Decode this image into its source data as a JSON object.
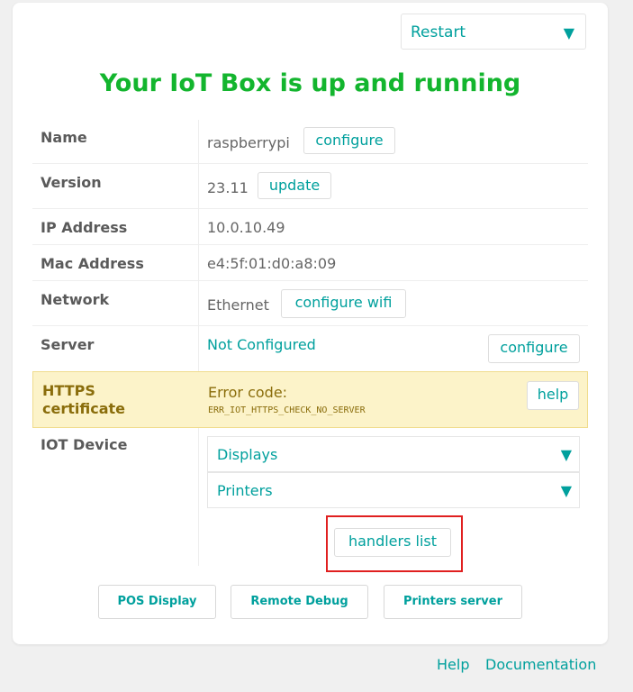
{
  "header": {
    "restart_label": "Restart",
    "restart_icon": "triangle-down-icon",
    "title": "Your IoT Box is up and running"
  },
  "rows": {
    "name": {
      "label": "Name",
      "value": "raspberrypi",
      "action": "configure"
    },
    "version": {
      "label": "Version",
      "value": "23.11",
      "action": "update"
    },
    "ip": {
      "label": "IP Address",
      "value": "10.0.10.49"
    },
    "mac": {
      "label": "Mac Address",
      "value": "e4:5f:01:d0:a8:09"
    },
    "network": {
      "label": "Network",
      "value": "Ethernet",
      "action": "configure wifi"
    },
    "server": {
      "label": "Server",
      "value": "Not Configured",
      "action": "configure"
    },
    "https": {
      "label": "HTTPS certificate",
      "value": "Error code:",
      "code": "ERR_IOT_HTTPS_CHECK_NO_SERVER",
      "action": "help"
    },
    "iot": {
      "label": "IOT Device",
      "dropdowns": [
        {
          "label": "Displays"
        },
        {
          "label": "Printers"
        }
      ],
      "handlers": "handlers list"
    }
  },
  "bottom_buttons": [
    "POS Display",
    "Remote Debug",
    "Printers server"
  ],
  "footer": {
    "help": "Help",
    "docs": "Documentation"
  },
  "colors": {
    "accent": "#00a09d",
    "title_green": "#13b52e",
    "warning_bg": "#fcf3c9",
    "highlight_red": "#e02020"
  }
}
